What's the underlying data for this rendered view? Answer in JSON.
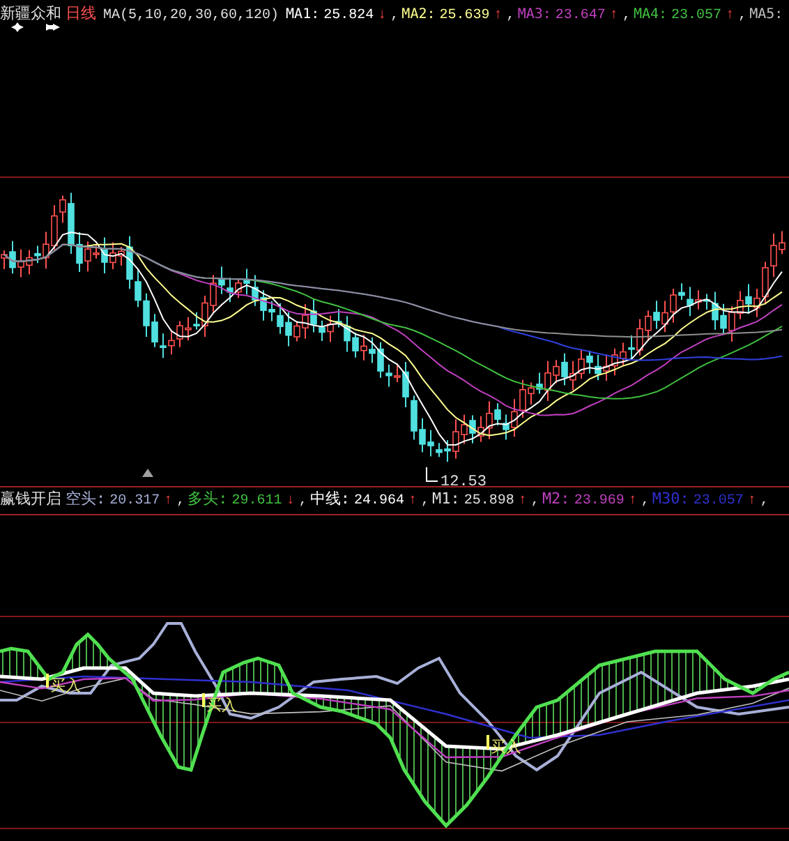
{
  "header": {
    "stock_name": "新疆众和",
    "period": "日线",
    "formula": "MA(5,10,20,30,60,120)",
    "indicators": [
      {
        "label": "MA1:",
        "value": "25.824",
        "arrow": "↓",
        "color": "#ffffff",
        "separator": ","
      },
      {
        "label": "MA2:",
        "value": "25.639",
        "arrow": "↑",
        "color": "#ffff90",
        "separator": ","
      },
      {
        "label": "MA3:",
        "value": "23.647",
        "arrow": "↑",
        "color": "#c040c0",
        "separator": ","
      },
      {
        "label": "MA4:",
        "value": "23.057",
        "arrow": "↑",
        "color": "#40c040",
        "separator": ","
      },
      {
        "label": "MA5:",
        "color": "#c0c0c0"
      }
    ]
  },
  "price_chart": {
    "low_label": "12.53"
  },
  "indicator_header": {
    "title": "赢钱开启",
    "indicators": [
      {
        "label": "空头:",
        "value": "20.317",
        "arrow": "↑",
        "color": "#a8b0d8",
        "separator": ","
      },
      {
        "label": "多头:",
        "value": "29.611",
        "arrow": "↓",
        "color": "#40c040",
        "separator": ","
      },
      {
        "label": "中线:",
        "value": "24.964",
        "arrow": "↑",
        "color": "#ffffff",
        "separator": ","
      },
      {
        "label": "M1:",
        "value": "25.898",
        "arrow": "↑",
        "color": "#e0e0e0",
        "separator": ","
      },
      {
        "label": "M2:",
        "value": "23.969",
        "arrow": "↑",
        "color": "#c040c0",
        "separator": ","
      },
      {
        "label": "M30:",
        "value": "23.057",
        "arrow": "↑",
        "color": "#3030d0",
        "separator": ","
      }
    ]
  },
  "indicator_chart": {
    "signals": [
      {
        "label": "买入"
      },
      {
        "label": "买入"
      },
      {
        "label": "买入"
      }
    ]
  }
}
